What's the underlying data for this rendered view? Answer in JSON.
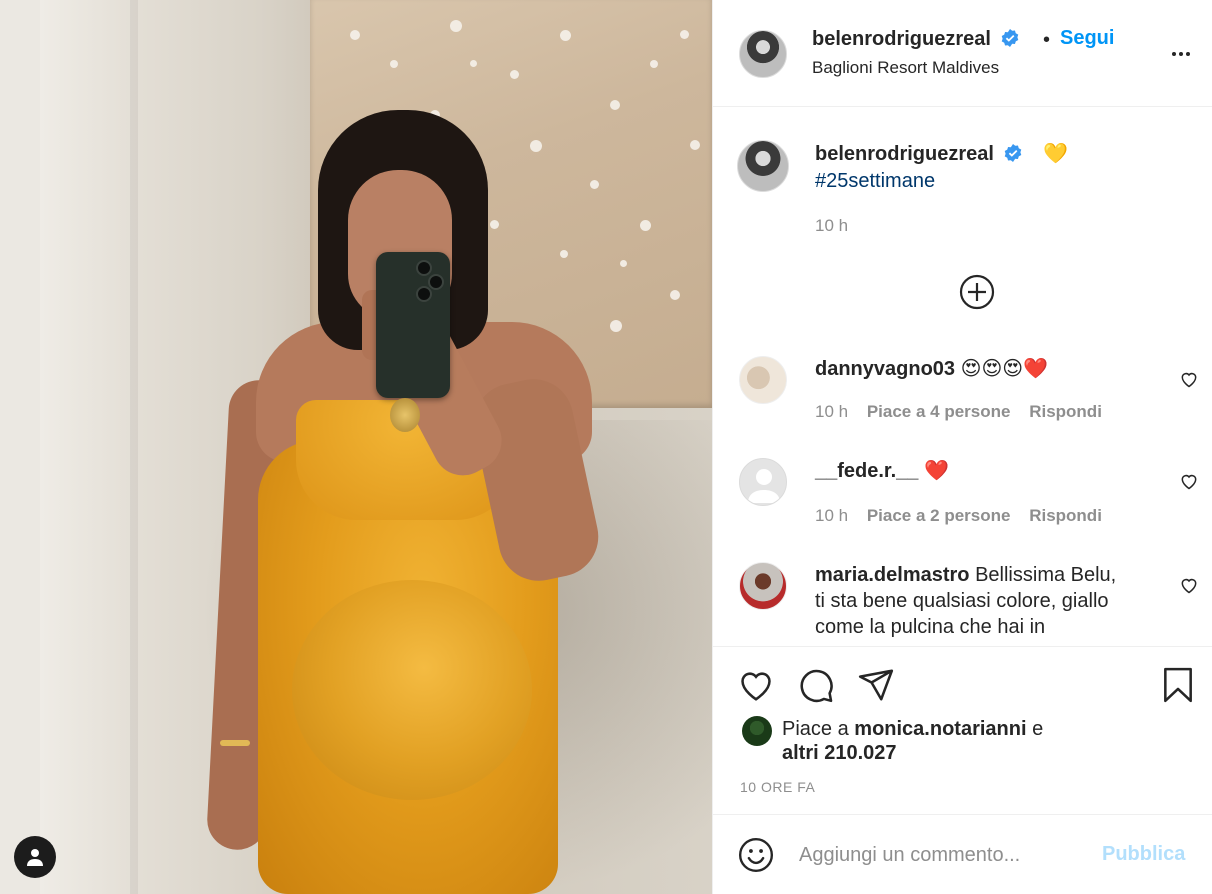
{
  "post": {
    "author": "belenrodriguezreal",
    "location": "Baglioni Resort Maldives",
    "follow_label": "Segui",
    "separator": "•"
  },
  "caption": {
    "username": "belenrodriguezreal",
    "emoji": "💛",
    "hashtag": "#25settimane",
    "time": "10 h"
  },
  "comments": [
    {
      "username": "dannyvagno03",
      "text": "😍😍😍❤️",
      "time": "10 h",
      "likes": "Piace a 4 persone",
      "reply": "Rispondi"
    },
    {
      "username": "__fede.r.__",
      "text": "❤️",
      "time": "10 h",
      "likes": "Piace a 2 persone",
      "reply": "Rispondi"
    },
    {
      "username": "maria.delmastro",
      "text_line1": "Bellissima Belu,",
      "text_line2": "ti sta bene qualsiasi colore, giallo",
      "text_line3": "come la pulcina che hai in"
    }
  ],
  "likes": {
    "prefix": "Piace a",
    "user": "monica.notarianni",
    "suffix": "e",
    "others": "altri 210.027"
  },
  "timestamp": "10 ORE FA",
  "compose": {
    "placeholder": "Aggiungi un commento...",
    "publish_label": "Pubblica"
  },
  "colors": {
    "accent": "#0095f6",
    "publish_disabled": "#b2dffc",
    "hashtag": "#00376b",
    "secondary_text": "#8e8e8e",
    "heart_red": "#ed4956"
  }
}
